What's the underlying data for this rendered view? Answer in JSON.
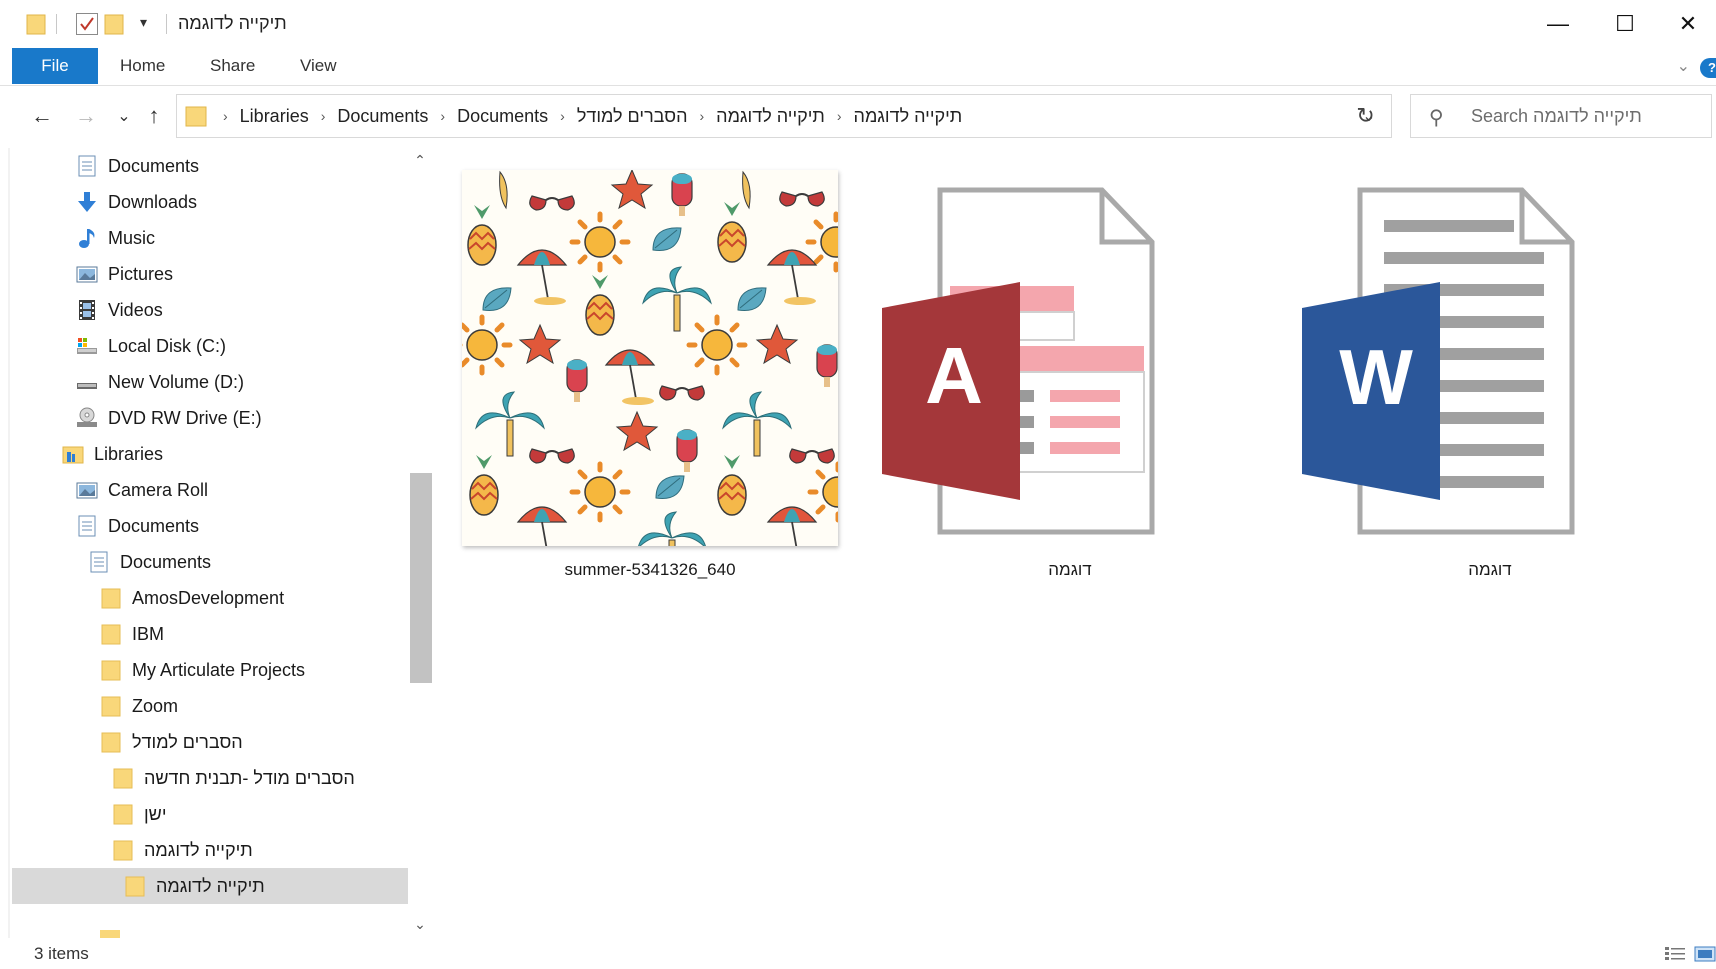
{
  "window": {
    "title": "תיקייה לדוגמה",
    "minimize_glyph": "—",
    "maximize_glyph": "☐",
    "close_glyph": "✕"
  },
  "ribbon": {
    "tabs": [
      {
        "label": "File"
      },
      {
        "label": "Home"
      },
      {
        "label": "Share"
      },
      {
        "label": "View"
      }
    ],
    "expand_glyph": "⌄",
    "help_glyph": "?"
  },
  "address_bar": {
    "breadcrumbs": [
      "Libraries",
      "Documents",
      "Documents",
      "הסברים למודל",
      "תיקייה לדוגמה",
      "תיקייה לדוגמה"
    ],
    "separator": "›",
    "dropdown_glyph": "⌄",
    "refresh_glyph": "↻",
    "back_glyph": "←",
    "forward_glyph": "→",
    "recent_glyph": "⌄",
    "up_glyph": "↑"
  },
  "search": {
    "placeholder": "Search תיקייה לדוגמה",
    "icon": "search-icon"
  },
  "nav_tree": [
    {
      "label": "Documents",
      "icon": "documents-icon",
      "indent": 1
    },
    {
      "label": "Downloads",
      "icon": "download-arrow-icon",
      "indent": 1
    },
    {
      "label": "Music",
      "icon": "music-note-icon",
      "indent": 1
    },
    {
      "label": "Pictures",
      "icon": "pictures-icon",
      "indent": 1
    },
    {
      "label": "Videos",
      "icon": "film-icon",
      "indent": 1
    },
    {
      "label": "Local Disk (C:)",
      "icon": "system-drive-icon",
      "indent": 1
    },
    {
      "label": "New Volume (D:)",
      "icon": "drive-icon",
      "indent": 1
    },
    {
      "label": "DVD RW Drive (E:)",
      "icon": "dvd-drive-icon",
      "indent": 1
    },
    {
      "label": "Libraries",
      "icon": "libraries-icon",
      "indent": 0
    },
    {
      "label": "Camera Roll",
      "icon": "pictures-icon",
      "indent": 1
    },
    {
      "label": "Documents",
      "icon": "documents-icon",
      "indent": 1
    },
    {
      "label": "Documents",
      "icon": "documents-icon",
      "indent": 2
    },
    {
      "label": "AmosDevelopment",
      "icon": "folder-icon",
      "indent": 3
    },
    {
      "label": "IBM",
      "icon": "folder-icon",
      "indent": 3
    },
    {
      "label": "My Articulate Projects",
      "icon": "folder-icon",
      "indent": 3
    },
    {
      "label": "Zoom",
      "icon": "folder-icon",
      "indent": 3
    },
    {
      "label": "הסברים למודל",
      "icon": "folder-icon",
      "indent": 3
    },
    {
      "label": "הסברים מודל -תבנית חדשה",
      "icon": "folder-icon",
      "indent": 4
    },
    {
      "label": "ישן",
      "icon": "folder-icon",
      "indent": 4
    },
    {
      "label": "תיקייה לדוגמה",
      "icon": "folder-icon",
      "indent": 4
    },
    {
      "label": "תיקייה לדוגמה",
      "icon": "folder-icon",
      "indent": 5,
      "selected": true
    }
  ],
  "scrollbar": {
    "up_glyph": "⌃",
    "down_glyph": "⌄"
  },
  "files": [
    {
      "name": "summer-5341326_640",
      "type": "image",
      "icon": "image-thumbnail"
    },
    {
      "name": "דוגמה",
      "type": "access",
      "icon": "access-file-icon",
      "letter": "A"
    },
    {
      "name": "דוגמה",
      "type": "word",
      "icon": "word-file-icon",
      "letter": "W"
    }
  ],
  "status": {
    "item_count": "3 items"
  },
  "colors": {
    "accent": "#1979ca",
    "folder": "#f9d77a",
    "access_red": "#a4373a",
    "access_pink": "#f4a6ad",
    "word_blue": "#2b579a",
    "selection": "#d9d9d9"
  }
}
